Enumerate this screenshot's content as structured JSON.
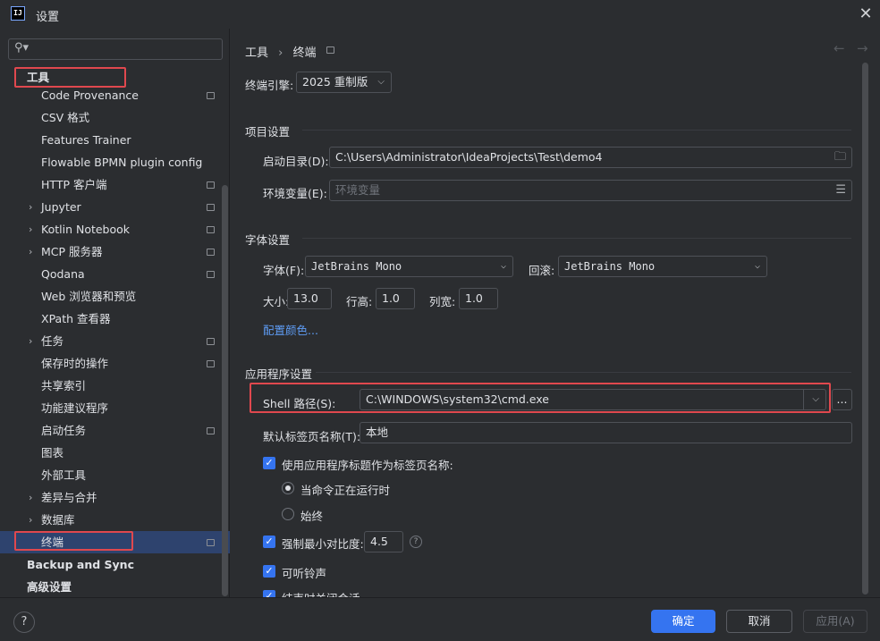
{
  "window": {
    "title": "设置",
    "app_icon": "IJ"
  },
  "search": {
    "placeholder": "",
    "icon": "search-icon"
  },
  "sidebar": {
    "root": "工具",
    "items": [
      {
        "label": "Code Provenance",
        "chevron": false,
        "mod": true
      },
      {
        "label": "CSV 格式",
        "chevron": false,
        "mod": false
      },
      {
        "label": "Features Trainer",
        "chevron": false,
        "mod": false
      },
      {
        "label": "Flowable BPMN plugin config",
        "chevron": false,
        "mod": false
      },
      {
        "label": "HTTP 客户端",
        "chevron": false,
        "mod": true
      },
      {
        "label": "Jupyter",
        "chevron": true,
        "mod": true
      },
      {
        "label": "Kotlin Notebook",
        "chevron": true,
        "mod": true
      },
      {
        "label": "MCP 服务器",
        "chevron": true,
        "mod": true
      },
      {
        "label": "Qodana",
        "chevron": false,
        "mod": true
      },
      {
        "label": "Web 浏览器和预览",
        "chevron": false,
        "mod": false
      },
      {
        "label": "XPath 查看器",
        "chevron": false,
        "mod": false
      },
      {
        "label": "任务",
        "chevron": true,
        "mod": true
      },
      {
        "label": "保存时的操作",
        "chevron": false,
        "mod": true
      },
      {
        "label": "共享索引",
        "chevron": false,
        "mod": false
      },
      {
        "label": "功能建议程序",
        "chevron": false,
        "mod": false
      },
      {
        "label": "启动任务",
        "chevron": false,
        "mod": true
      },
      {
        "label": "图表",
        "chevron": false,
        "mod": false
      },
      {
        "label": "外部工具",
        "chevron": false,
        "mod": false
      },
      {
        "label": "差异与合并",
        "chevron": true,
        "mod": false
      },
      {
        "label": "数据库",
        "chevron": true,
        "mod": false
      },
      {
        "label": "终端",
        "chevron": false,
        "mod": true,
        "selected": true
      }
    ],
    "bottom": [
      "Backup and Sync",
      "高级设置"
    ]
  },
  "breadcrumb": {
    "parent": "工具",
    "sep": "›",
    "current": "终端"
  },
  "engine": {
    "label": "终端引擎:",
    "value": "2025 重制版"
  },
  "project": {
    "title": "项目设置",
    "start_dir_label": "启动目录(D):",
    "start_dir_value": "C:\\Users\\Administrator\\IdeaProjects\\Test\\demo4",
    "env_label": "环境变量(E):",
    "env_placeholder": "环境变量"
  },
  "font": {
    "title": "字体设置",
    "font_label": "字体(F):",
    "font_value": "JetBrains Mono",
    "fallback_label": "回滚:",
    "fallback_value": "JetBrains Mono",
    "size_label": "大小:",
    "size_value": "13.0",
    "line_label": "行高:",
    "line_value": "1.0",
    "col_label": "列宽:",
    "col_value": "1.0",
    "color_link": "配置颜色..."
  },
  "app": {
    "title": "应用程序设置",
    "shell_label": "Shell 路径(S):",
    "shell_value": "C:\\WINDOWS\\system32\\cmd.exe",
    "browse": "...",
    "tab_name_label": "默认标签页名称(T):",
    "tab_name_value": "本地",
    "use_title_label": "使用应用程序标题作为标签页名称:",
    "radio_running": "当命令正在运行时",
    "radio_always": "始终",
    "contrast_label": "强制最小对比度:",
    "contrast_value": "4.5",
    "bell_label": "可听铃声",
    "cut_label": "结束时关闭会话"
  },
  "footer": {
    "help": "?",
    "ok": "确定",
    "cancel": "取消",
    "apply": "应用(A)"
  },
  "colors": {
    "accent": "#3574f0",
    "highlight": "#e0484e",
    "selected": "#2e436e",
    "link": "#5e9cf5"
  }
}
